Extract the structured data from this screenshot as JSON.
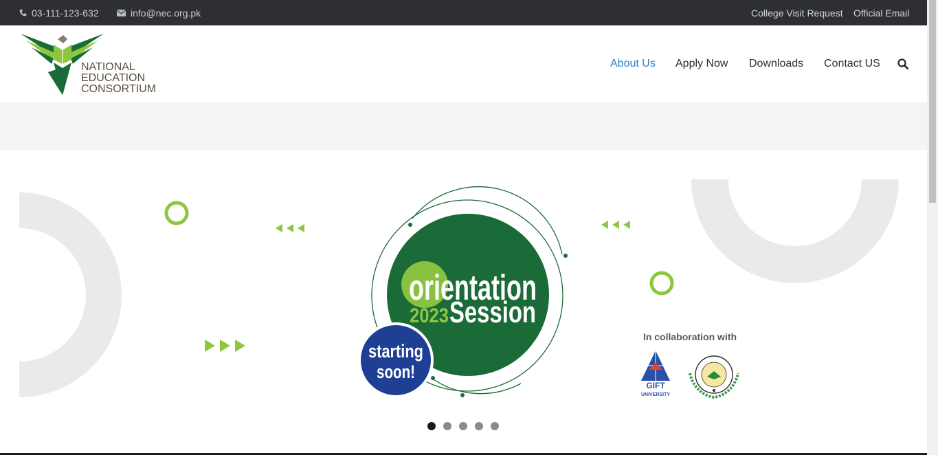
{
  "topbar": {
    "phone": "03-111-123-632",
    "email": "info@nec.org.pk",
    "college_visit": "College Visit Request",
    "official_email": "Official Email"
  },
  "logo": {
    "line1": "NATIONAL",
    "line2": "EDUCATION",
    "line3": "CONSORTIUM"
  },
  "nav": {
    "items": [
      {
        "label": "About Us",
        "active": true
      },
      {
        "label": "Apply Now",
        "active": false
      },
      {
        "label": "Downloads",
        "active": false
      },
      {
        "label": "Contact US",
        "active": false
      }
    ],
    "search_icon": "search-icon"
  },
  "slide": {
    "headline_1": "orientation",
    "headline_2": "Session",
    "year": "2023",
    "badge_line1": "starting",
    "badge_line2": "soon!",
    "collab": "In collaboration with",
    "partner1": "GIFT UNIVERSITY",
    "partner2_seal": "Punjab Educational Endowment Fund"
  },
  "carousel": {
    "count": 5,
    "active_index": 0
  },
  "colors": {
    "topbar": "#2e2f33",
    "nav_active": "#2c83c9",
    "green_dark": "#1a6b37",
    "green_light": "#8dc63f",
    "badge_blue": "#1f3f95"
  }
}
